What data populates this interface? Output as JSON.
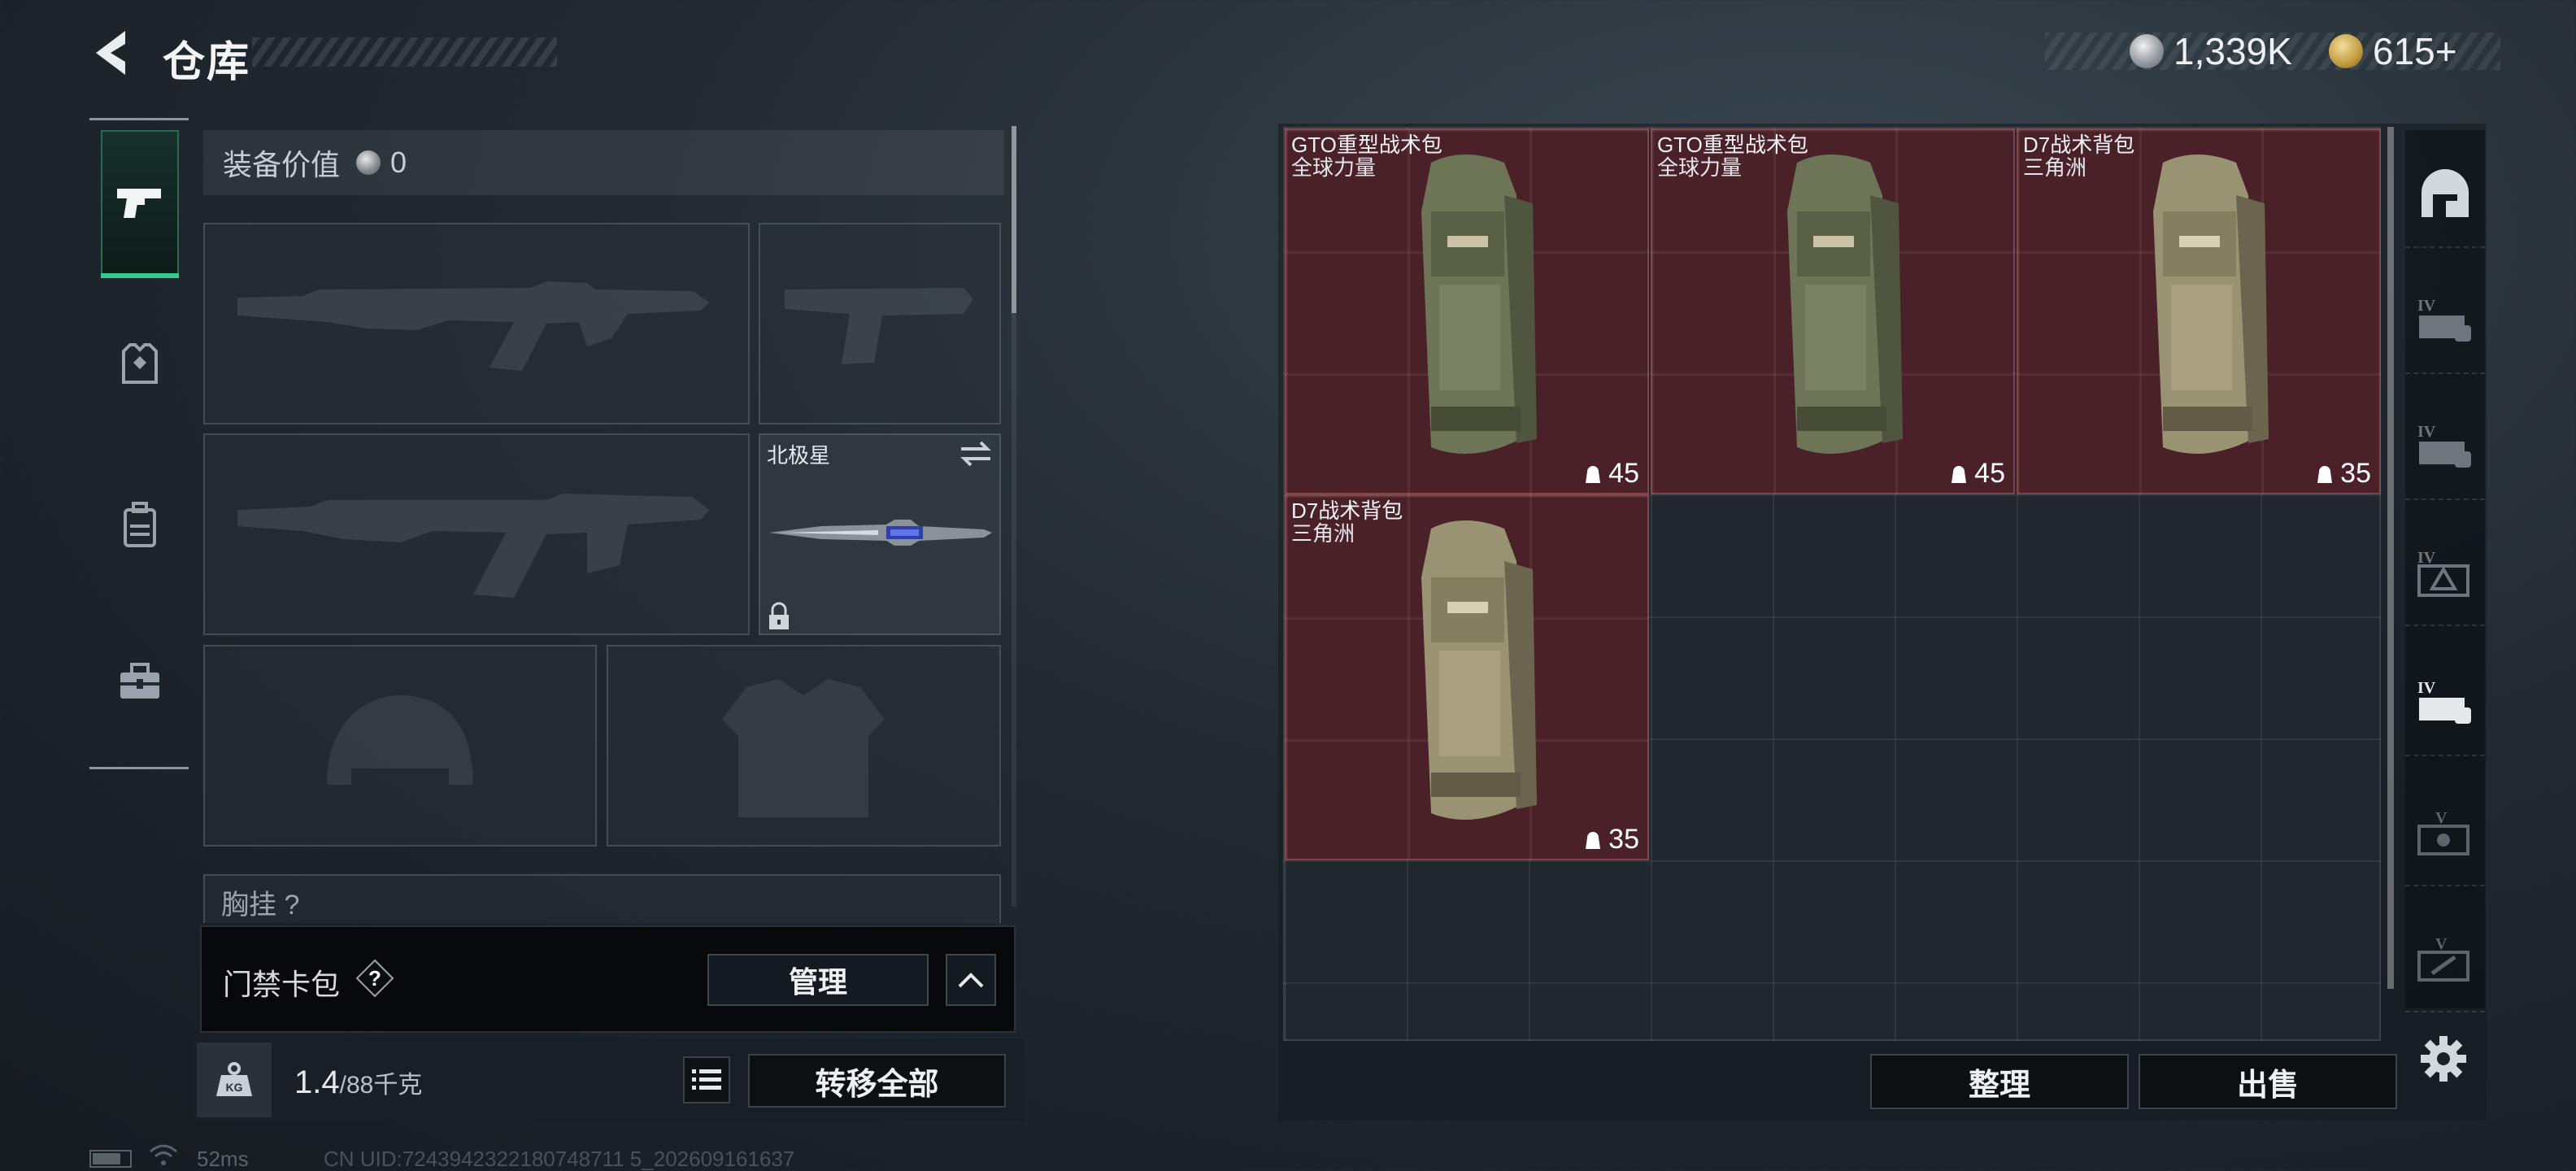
{
  "header": {
    "title": "仓库",
    "currency": {
      "silver": "1,339K",
      "gold": "615+"
    }
  },
  "side_tabs": [
    {
      "icon": "pistol-icon",
      "active": true
    },
    {
      "icon": "armor-icon",
      "active": false
    },
    {
      "icon": "backpack-icon",
      "active": false
    },
    {
      "icon": "toolbox-icon",
      "active": false
    }
  ],
  "equipment": {
    "value_label": "装备价值",
    "value": "0",
    "melee": {
      "name": "北极星",
      "locked": true
    },
    "chest_label": "胸挂",
    "chest_count": "?"
  },
  "keycard": {
    "label": "门禁卡包",
    "help": "?",
    "manage": "管理"
  },
  "capacity": {
    "current": "1.4",
    "max": "88",
    "unit": "千克",
    "transfer_all": "转移全部"
  },
  "storage": {
    "items": [
      {
        "name": "GTO重型战术包",
        "brand": "全球力量",
        "capacity": "45",
        "tint": "green"
      },
      {
        "name": "GTO重型战术包",
        "brand": "全球力量",
        "capacity": "45",
        "tint": "green"
      },
      {
        "name": "D7战术背包",
        "brand": "三角洲",
        "capacity": "35",
        "tint": "khaki"
      },
      {
        "name": "D7战术背包",
        "brand": "三角洲",
        "capacity": "35",
        "tint": "khaki"
      }
    ],
    "sort": "整理",
    "sell": "出售",
    "categories": [
      {
        "icon": "all-storage-icon",
        "level": ""
      },
      {
        "icon": "weapon-case-icon",
        "level": "IV"
      },
      {
        "icon": "weapon-case-icon",
        "level": "IV"
      },
      {
        "icon": "armor-case-icon",
        "level": "IV"
      },
      {
        "icon": "weapon-case-icon",
        "level": "IV"
      },
      {
        "icon": "ammo-case-icon",
        "level": "V"
      },
      {
        "icon": "ammo-case-icon",
        "level": "V"
      }
    ]
  },
  "status": {
    "ping": "52ms",
    "uid": "CN UID:7243942322180748711 5_202609161637"
  },
  "colors": {
    "accent_green": "#35c98d",
    "item_bg_red": "#6a1f28"
  }
}
